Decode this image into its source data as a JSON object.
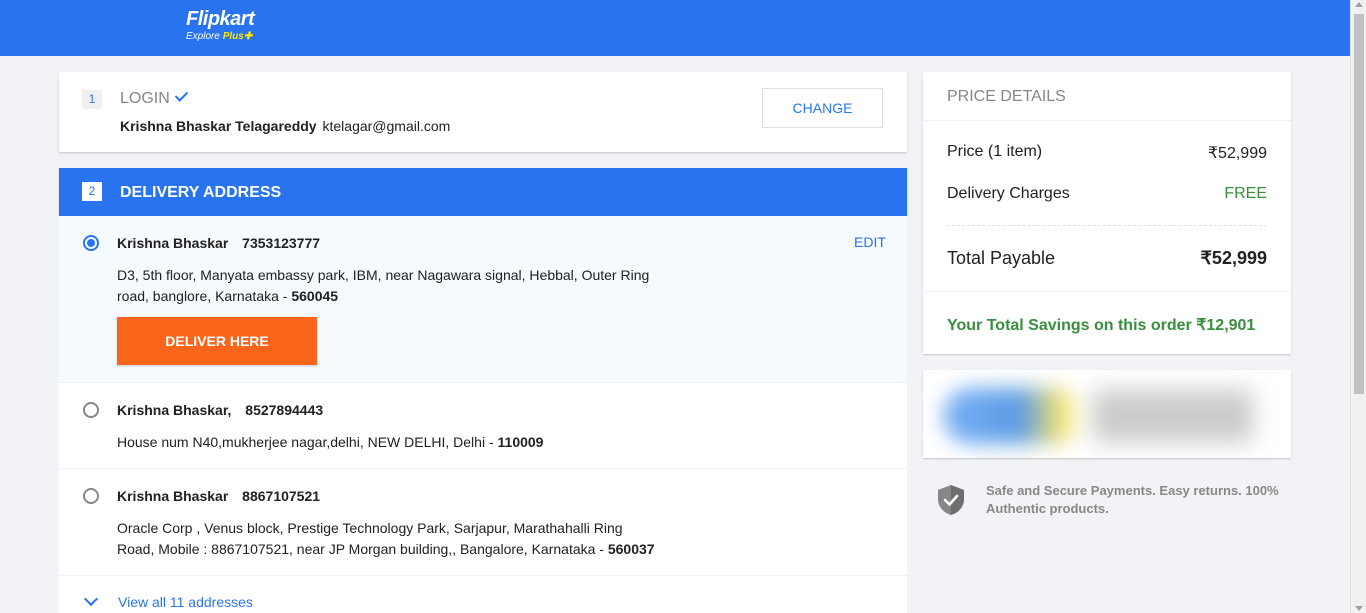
{
  "brand": {
    "name": "Flipkart",
    "tagline_prefix": "Explore ",
    "tagline_plus": "Plus",
    "colors": {
      "primary": "#2874f0",
      "accent": "#fb641b",
      "success": "#388e3c",
      "plus_yellow": "#ffe500"
    }
  },
  "login": {
    "step": "1",
    "title": "LOGIN",
    "name": "Krishna Bhaskar Telagareddy",
    "email": "ktelagar@gmail.com",
    "change_label": "CHANGE"
  },
  "delivery": {
    "step": "2",
    "title": "DELIVERY ADDRESS",
    "edit_label": "EDIT",
    "deliver_label": "DELIVER HERE",
    "addresses": [
      {
        "name": "Krishna Bhaskar",
        "phone": "7353123777",
        "address": "D3, 5th floor, Manyata embassy park, IBM, near Nagawara signal, Hebbal, Outer Ring road, banglore, Karnataka - ",
        "pincode": "560045",
        "selected": true
      },
      {
        "name": "Krishna Bhaskar,",
        "phone": "8527894443",
        "address": "House num N40,mukherjee nagar,delhi, NEW DELHI, Delhi - ",
        "pincode": "110009",
        "selected": false
      },
      {
        "name": "Krishna Bhaskar",
        "phone": "8867107521",
        "address": "Oracle Corp , Venus block, Prestige Technology Park, Sarjapur, Marathahalli Ring Road, Mobile : 8867107521, near JP Morgan building,, Bangalore, Karnataka - ",
        "pincode": "560037",
        "selected": false
      }
    ],
    "view_all_label": "View all 11 addresses"
  },
  "price_details": {
    "title": "PRICE DETAILS",
    "price_label": "Price (1 item)",
    "price_value": "₹52,999",
    "delivery_label": "Delivery Charges",
    "delivery_value": "FREE",
    "total_label": "Total Payable",
    "total_value": "₹52,999",
    "savings": "Your Total Savings on this order ₹12,901"
  },
  "safe_payments": {
    "text": "Safe and Secure Payments. Easy returns. 100% Authentic products.",
    "icon": "shield-check-icon"
  }
}
